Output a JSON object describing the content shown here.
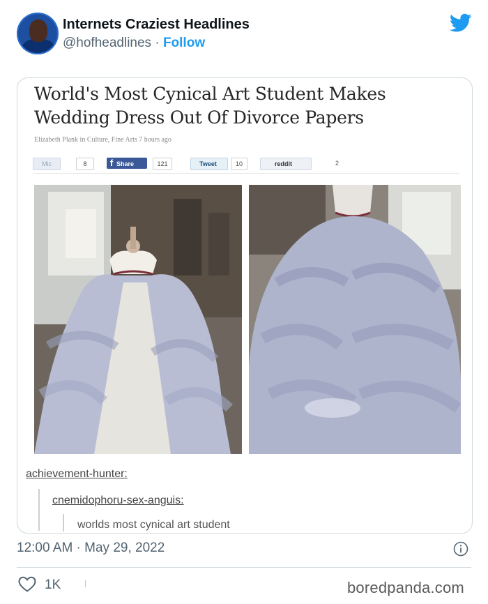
{
  "tweet": {
    "display_name": "Internets Craziest Headlines",
    "handle": "@hofheadlines",
    "separator": "·",
    "follow_label": "Follow",
    "timestamp": "12:00 AM · May 29, 2022",
    "likes": "1K",
    "brand_color": "#1d9bf0"
  },
  "article": {
    "title_line1": "World's Most Cynical Art Student Makes",
    "title_line2": "Wedding Dress Out Of Divorce Papers",
    "byline": "Elizabeth Plank in Culture, Fine Arts 7 hours ago",
    "share": {
      "like_label": "Mic",
      "like_count": "8",
      "facebook_label": "Share",
      "facebook_count": "121",
      "tweet_label": "Tweet",
      "tweet_count": "10",
      "reddit_label": "reddit",
      "other_count": "2"
    }
  },
  "comments": [
    {
      "author": "achievement-hunter:"
    },
    {
      "author": "cnemidophoru-sex-anguis:"
    },
    {
      "text": "worlds most cynical art student"
    }
  ],
  "watermark": "boredpanda.com"
}
